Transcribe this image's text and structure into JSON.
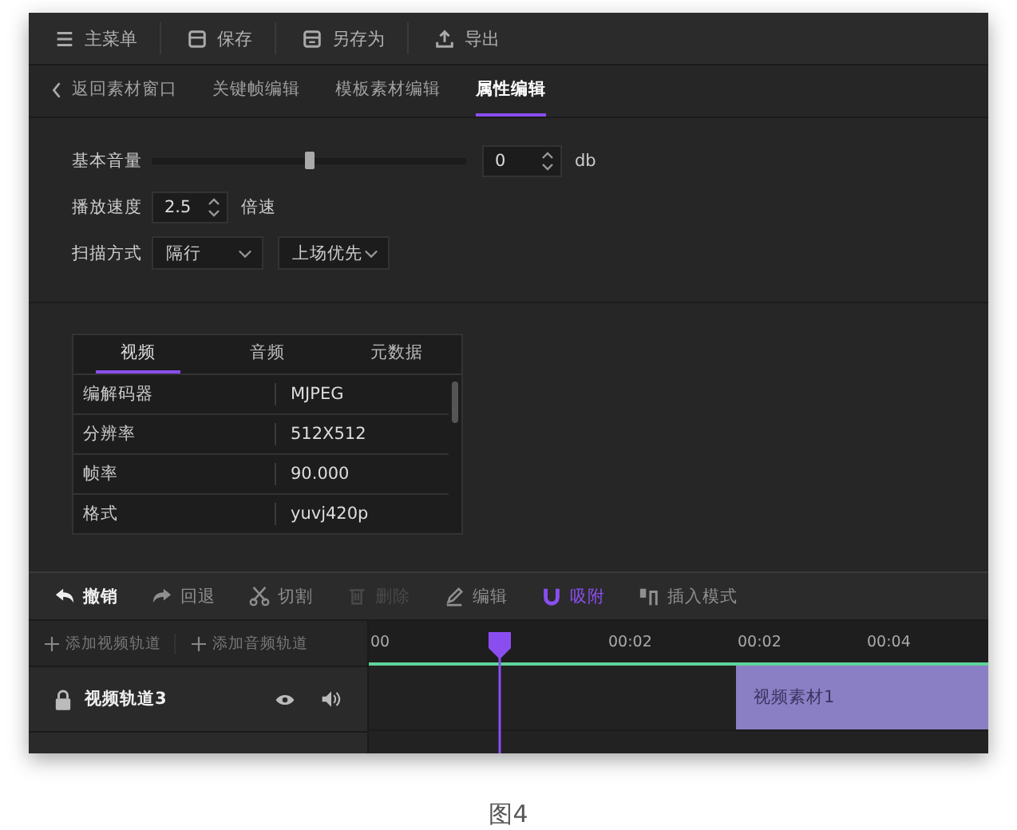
{
  "toolbar": [
    {
      "label": "主菜单"
    },
    {
      "label": "保存"
    },
    {
      "label": "另存为"
    },
    {
      "label": "导出"
    }
  ],
  "tabs": {
    "back": "返回素材窗口",
    "items": [
      {
        "label": "关键帧编辑",
        "selected": false
      },
      {
        "label": "模板素材编辑",
        "selected": false
      },
      {
        "label": "属性编辑",
        "selected": true
      }
    ]
  },
  "properties": {
    "volume": {
      "label": "基本音量",
      "level": 0.5,
      "value": "0",
      "unit": "db"
    },
    "speed": {
      "label": "播放速度",
      "value": "2.5",
      "unit": "倍速"
    },
    "scan": {
      "label": "扫描方式",
      "options": [
        "隔行",
        "上场优先"
      ]
    }
  },
  "info": {
    "tabs": [
      {
        "label": "视频",
        "selected": true
      },
      {
        "label": "音频",
        "selected": false
      },
      {
        "label": "元数据",
        "selected": false
      }
    ],
    "rows": [
      {
        "key": "编解码器",
        "value": "MJPEG"
      },
      {
        "key": "分辨率",
        "value": "512X512"
      },
      {
        "key": "帧率",
        "value": "90.000"
      },
      {
        "key": "格式",
        "value": "yuvj420p"
      }
    ]
  },
  "timeline_tools": [
    {
      "label": "撤销",
      "disabled": false,
      "on": false
    },
    {
      "label": "回退",
      "disabled": false,
      "on": false
    },
    {
      "label": "切割",
      "disabled": false,
      "on": false
    },
    {
      "label": "删除",
      "disabled": true,
      "on": false
    },
    {
      "label": "编辑",
      "disabled": false,
      "on": false
    },
    {
      "label": "吸附",
      "disabled": false,
      "on": true
    },
    {
      "label": "插入模式",
      "disabled": false,
      "on": false
    }
  ],
  "track_buttons": [
    "添加视频轨道",
    "添加音频轨道"
  ],
  "ruler": [
    "00",
    "00:02",
    "00:02",
    "00:04"
  ],
  "tracks": [
    {
      "name": "视频轨道3",
      "clip": "视频素材1"
    }
  ],
  "caption": "图4"
}
